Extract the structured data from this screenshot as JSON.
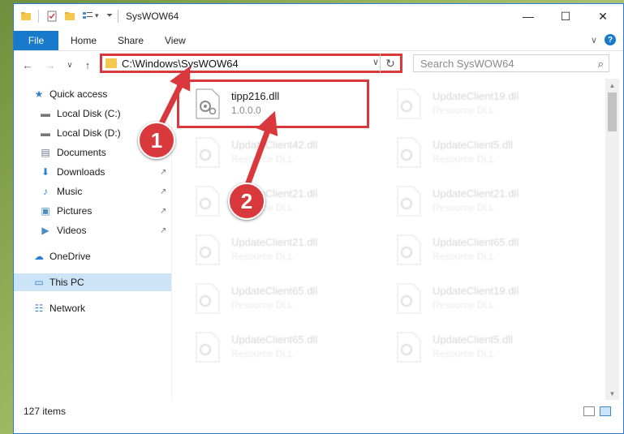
{
  "window": {
    "title": "SysWOW64",
    "controls": {
      "minimize": "—",
      "maximize": "☐",
      "close": "✕"
    }
  },
  "ribbon": {
    "tabs": [
      {
        "label": "File",
        "active": true
      },
      {
        "label": "Home"
      },
      {
        "label": "Share"
      },
      {
        "label": "View"
      }
    ],
    "expand_icon": "∨",
    "help_icon": "?"
  },
  "address_bar": {
    "path": "C:\\Windows\\SysWOW64",
    "dropdown_icon": "∨",
    "refresh_icon": "↻"
  },
  "search": {
    "placeholder": "Search SysWOW64",
    "icon": "⌕"
  },
  "nav_buttons": {
    "back": "←",
    "forward": "→",
    "recent": "∨",
    "up": "↑"
  },
  "sidebar": {
    "items": [
      {
        "label": "Quick access",
        "icon": "star-icon",
        "glyph": "★",
        "color": "#2f7fd0"
      },
      {
        "label": "Local Disk (C:)",
        "icon": "drive-icon",
        "glyph": "▬",
        "color": "#777777"
      },
      {
        "label": "Local Disk (D:)",
        "icon": "drive-icon",
        "glyph": "▬",
        "color": "#777777"
      },
      {
        "label": "Documents",
        "icon": "documents-icon",
        "glyph": "▤",
        "color": "#6b7b8c",
        "pinned": true
      },
      {
        "label": "Downloads",
        "icon": "downloads-icon",
        "glyph": "⬇",
        "color": "#2f7fd0",
        "pinned": true
      },
      {
        "label": "Music",
        "icon": "music-icon",
        "glyph": "♪",
        "color": "#2f7fd0",
        "pinned": true
      },
      {
        "label": "Pictures",
        "icon": "pictures-icon",
        "glyph": "▣",
        "color": "#4a8cc4",
        "pinned": true
      },
      {
        "label": "Videos",
        "icon": "videos-icon",
        "glyph": "▶",
        "color": "#4a8cc4",
        "pinned": true
      },
      {
        "label": "OneDrive",
        "icon": "onedrive-icon",
        "glyph": "☁",
        "color": "#2f7fd0"
      },
      {
        "label": "This PC",
        "icon": "computer-icon",
        "glyph": "▭",
        "color": "#2f7fd0",
        "selected": true
      },
      {
        "label": "Network",
        "icon": "network-icon",
        "glyph": "☷",
        "color": "#2f7fd0"
      }
    ],
    "pin_glyph": "↗"
  },
  "files": [
    {
      "name": "tipp216.dll",
      "type": "1.0.0.0",
      "highlighted": true
    },
    {
      "name": "UpdateClient19.dll",
      "type": "Resource DLL"
    },
    {
      "name": "UpdateClient42.dll",
      "type": "Resource DLL"
    },
    {
      "name": "UpdateClient5.dll",
      "type": "Resource DLL"
    },
    {
      "name": "UpdateClient21.dll",
      "type": "Resource DLL"
    },
    {
      "name": "UpdateClient21.dll",
      "type": "Resource DLL"
    },
    {
      "name": "UpdateClient21.dll",
      "type": "Resource DLL"
    },
    {
      "name": "UpdateClient65.dll",
      "type": "Resource DLL"
    },
    {
      "name": "UpdateClient65.dll",
      "type": "Resource DLL"
    },
    {
      "name": "UpdateClient19.dll",
      "type": "Resource DLL"
    },
    {
      "name": "UpdateClient65.dll",
      "type": "Resource DLL"
    },
    {
      "name": "UpdateClient5.dll",
      "type": "Resource DLL"
    }
  ],
  "status": {
    "item_count": "127 items"
  },
  "annotations": {
    "marker_1": "1",
    "marker_2": "2",
    "color": "#d9383c"
  }
}
